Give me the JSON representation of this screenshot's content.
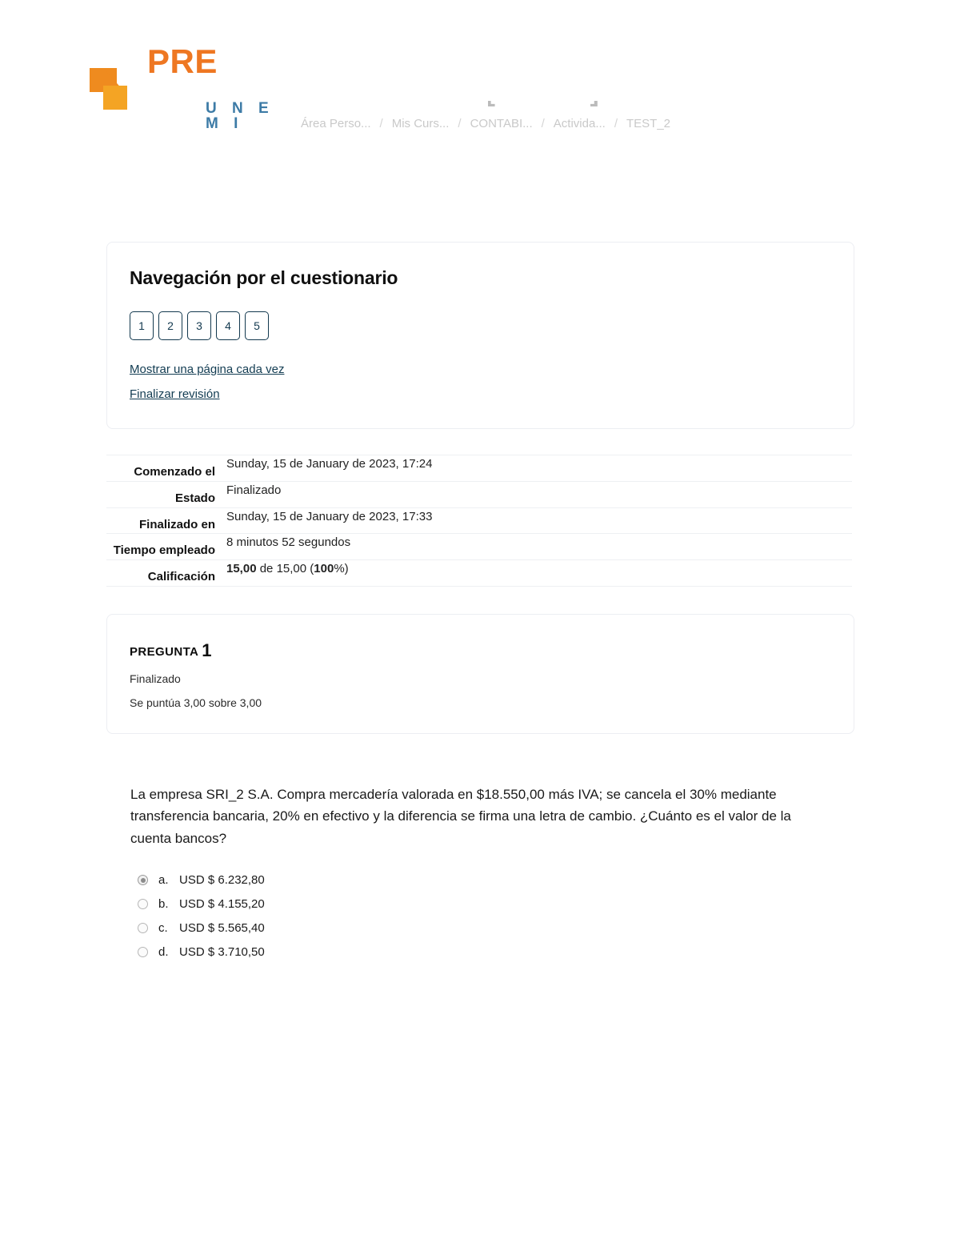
{
  "brand": {
    "logo_icon": "unemi-squares-logo",
    "pre_text": "PRE",
    "unemi_text": "U N E M I",
    "orange": "#ee7722",
    "orange_light": "#f4a424",
    "blue": "#3d7ba6"
  },
  "breadcrumb": {
    "items": [
      {
        "label": "Área Perso...",
        "tick": null
      },
      {
        "label": "Mis Curs...",
        "tick": null
      },
      {
        "label": "CONTABI...",
        "tick": "a"
      },
      {
        "label": "Activida...",
        "tick": "b"
      },
      {
        "label": "TEST_2",
        "tick": null
      }
    ],
    "separator": "/"
  },
  "quiz_navigation": {
    "title": "Navegación por el cuestionario",
    "question_buttons": [
      "1",
      "2",
      "3",
      "4",
      "5"
    ],
    "links": [
      "Mostrar una página cada vez",
      "Finalizar revisión"
    ],
    "link_color": "#123c52",
    "button_border_color": "#13394f"
  },
  "attempt_summary": {
    "rows": [
      {
        "label": "Comenzado el",
        "value": "Sunday, 15 de January de 2023, 17:24"
      },
      {
        "label": "Estado",
        "value": "Finalizado"
      },
      {
        "label": "Finalizado en",
        "value": "Sunday, 15 de January de 2023, 17:33"
      },
      {
        "label": "Tiempo empleado",
        "value": "8 minutos 52 segundos"
      },
      {
        "label": "Calificación",
        "value": "15,00 de 15,00 (100%)"
      }
    ],
    "grade_parts": {
      "earned": "15,00",
      "of": "de 15,00",
      "percent_open": "(",
      "percent": "100",
      "percent_sign": "%",
      "percent_close": ")"
    }
  },
  "question": {
    "label": "PREGUNTA",
    "number": "1",
    "state": "Finalizado",
    "marks": "Se puntúa 3,00 sobre 3,00",
    "text": "La empresa SRI_2 S.A. Compra mercadería valorada en $18.550,00 más IVA; se cancela el 30% mediante transferencia bancaria, 20% en efectivo y la diferencia se firma una letra de cambio. ¿Cuánto es el valor de la cuenta bancos?",
    "options": [
      {
        "key": "a.",
        "text": "USD $ 6.232,80",
        "selected": true
      },
      {
        "key": "b.",
        "text": "USD $ 4.155,20",
        "selected": false
      },
      {
        "key": "c.",
        "text": "USD $ 5.565,40",
        "selected": false
      },
      {
        "key": "d.",
        "text": "USD $ 3.710,50",
        "selected": false
      }
    ]
  }
}
